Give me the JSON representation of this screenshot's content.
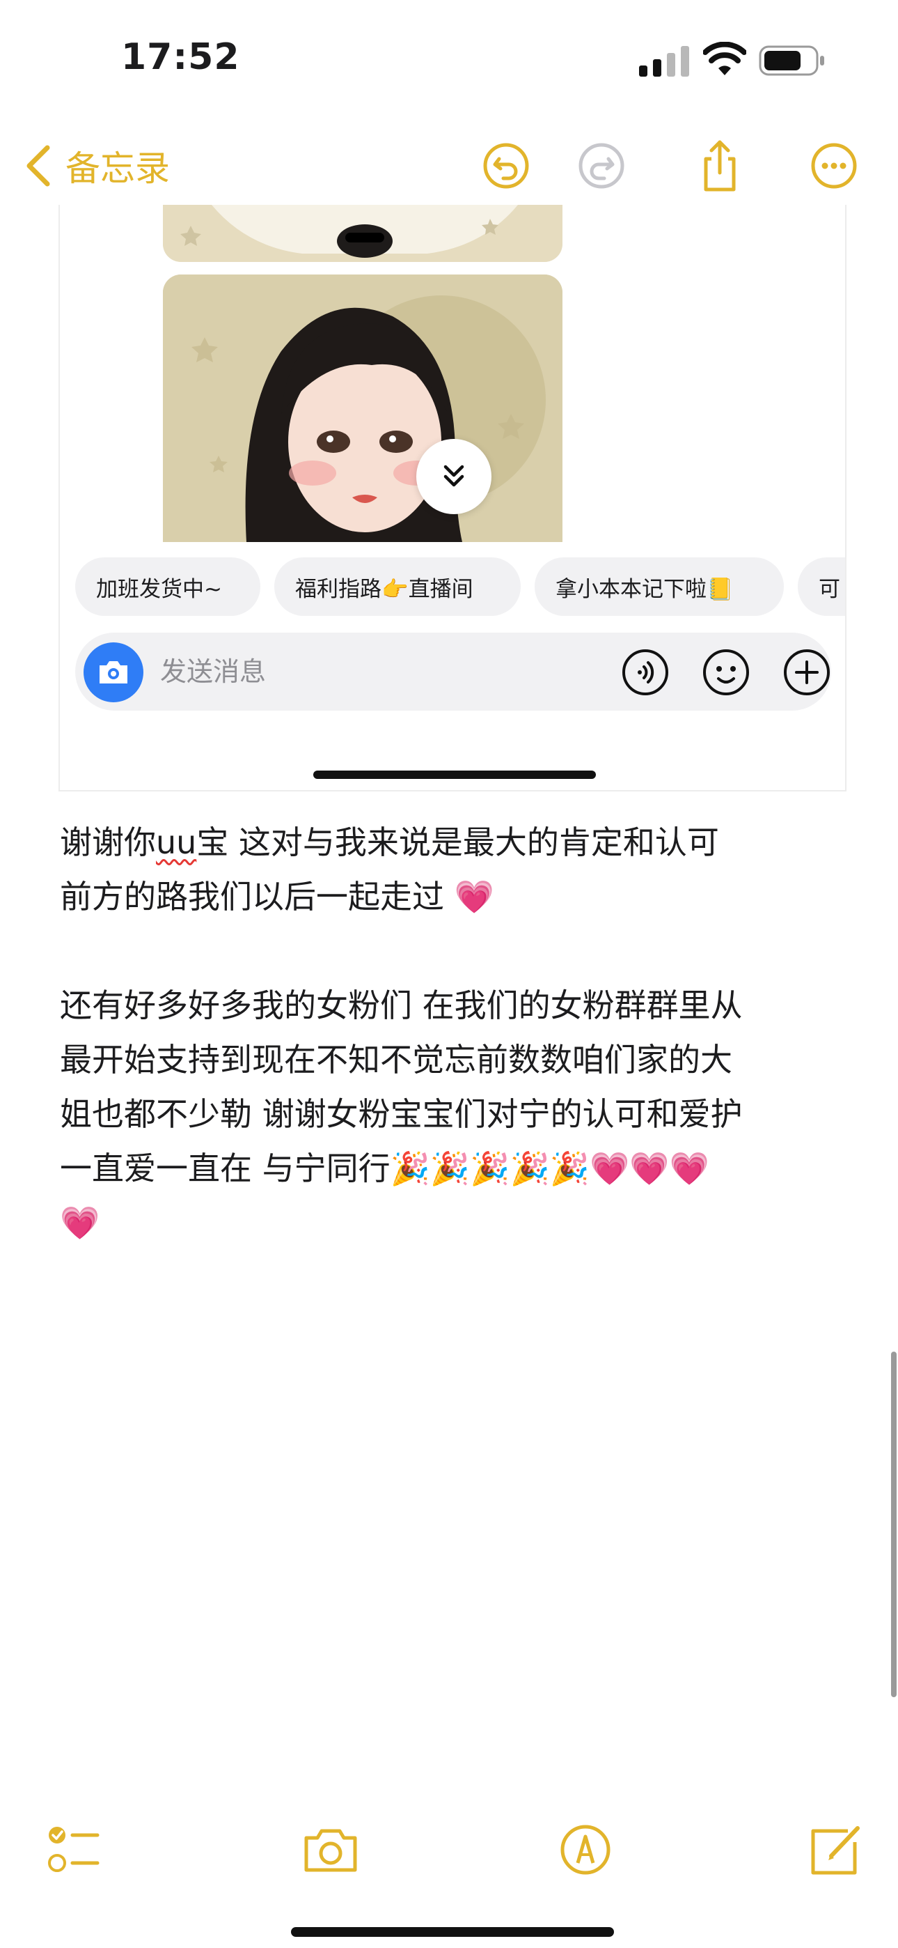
{
  "status_bar": {
    "time": "17:52"
  },
  "nav": {
    "back_label": "备忘录",
    "accent_color": "#E2B42B",
    "icons": [
      "undo-icon",
      "redo-icon",
      "share-icon",
      "more-icon"
    ]
  },
  "embedded_screenshot": {
    "chips": [
      "加班发货中~",
      "福利指路👉直播间",
      "拿小本本记下啦📒",
      "可"
    ],
    "message_placeholder": "发送消息",
    "icons": [
      "camera-icon",
      "voice-icon",
      "emoji-icon",
      "plus-icon",
      "double-chevron-down-icon"
    ]
  },
  "note": {
    "line1_a": "谢谢你",
    "line1_uu": "uu",
    "line1_b": "宝 这对与我来说是最大的肯定和认可",
    "line2": "前方的路我们以后一起走过 💗",
    "line3": "还有好多好多我的女粉们 在我们的女粉群群里从",
    "line4": "最开始支持到现在不知不觉忘前数数咱们家的大",
    "line5": "姐也都不少勒 谢谢女粉宝宝们对宁的认可和爱护",
    "line6": " 一直爱一直在 与宁同行🎉🎉🎉🎉🎉💗💗💗",
    "line7": "💗"
  },
  "toolbar": {
    "icons": [
      "checklist-icon",
      "camera-icon",
      "markup-icon",
      "compose-icon"
    ]
  }
}
